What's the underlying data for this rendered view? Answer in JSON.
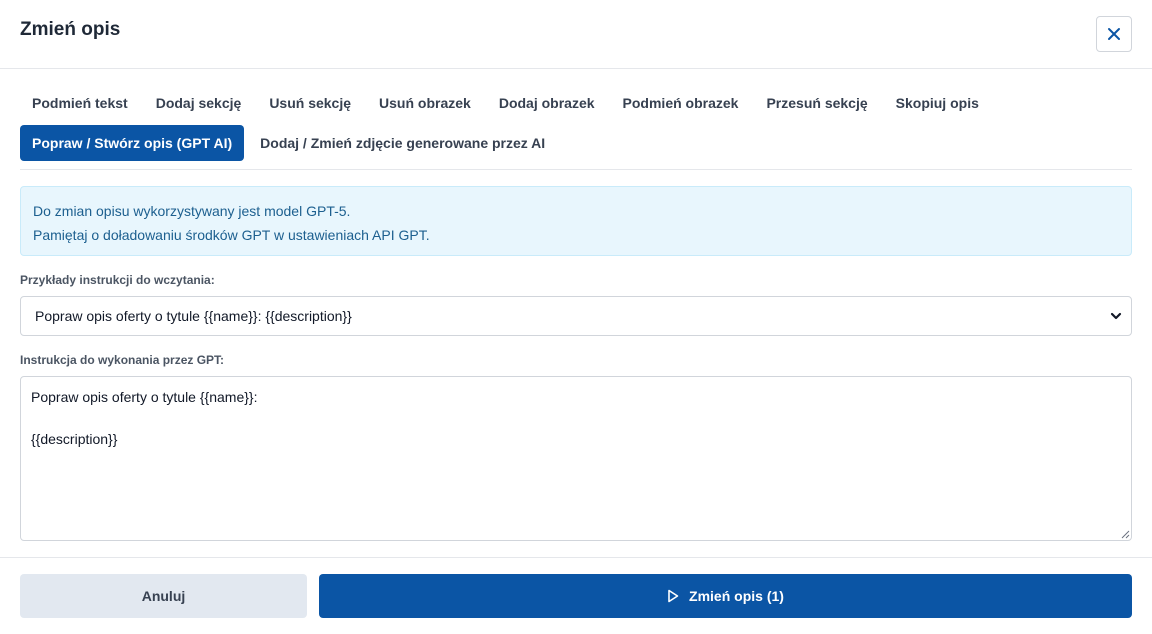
{
  "dialog": {
    "title": "Zmień opis"
  },
  "tabs": {
    "row1": [
      {
        "label": "Podmień tekst"
      },
      {
        "label": "Dodaj sekcję"
      },
      {
        "label": "Usuń sekcję"
      },
      {
        "label": "Usuń obrazek"
      },
      {
        "label": "Dodaj obrazek"
      },
      {
        "label": "Podmień obrazek"
      },
      {
        "label": "Przesuń sekcję"
      },
      {
        "label": "Skopiuj opis"
      }
    ],
    "row2": [
      {
        "label": "Popraw / Stwórz opis (GPT AI)",
        "active": true
      },
      {
        "label": "Dodaj / Zmień zdjęcie generowane przez AI"
      }
    ]
  },
  "info": {
    "line1": "Do zmian opisu wykorzystywany jest model GPT-5.",
    "line2": "Pamiętaj o doładowaniu środków GPT w ustawieniach API GPT."
  },
  "examples": {
    "label": "Przykłady instrukcji do wczytania:",
    "selected": "Popraw opis oferty o tytule {{name}}: {{description}}"
  },
  "instruction": {
    "label": "Instrukcja do wykonania przez GPT:",
    "value": "Popraw opis oferty o tytule {{name}}:\n\n{{description}}"
  },
  "footer": {
    "cancel_label": "Anuluj",
    "submit_label": "Zmień opis (1)"
  },
  "colors": {
    "primary": "#0b55a5",
    "info_bg": "#e8f6fd",
    "info_text": "#1c5f8f",
    "cancel_bg": "#e2e8f0"
  },
  "icons": {
    "close": "close-icon",
    "select": "chevron-down-icon",
    "submit": "play-icon"
  }
}
